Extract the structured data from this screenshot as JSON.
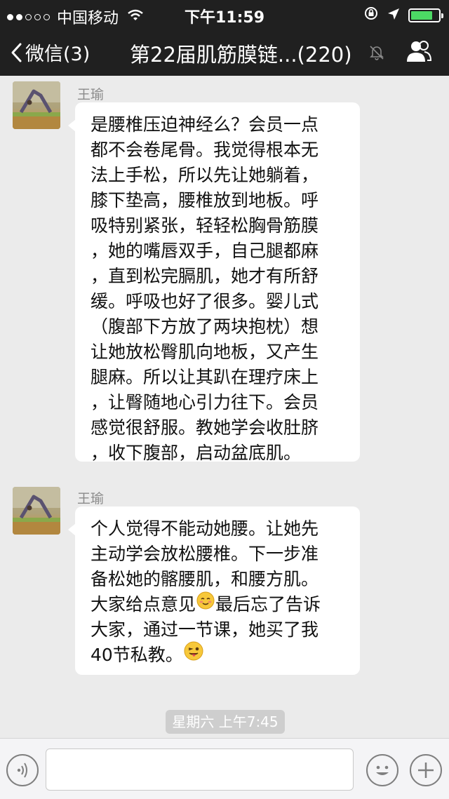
{
  "status_bar": {
    "signal_bars": 5,
    "signal_filled": 2,
    "carrier": "中国移动",
    "time": "下午11:59",
    "battery_color": "#4cd964",
    "battery_level": 0.82
  },
  "nav": {
    "back_label": "微信(3)",
    "title": "第22届肌筋膜链...(220)",
    "icons": [
      "chevron-left-icon",
      "mute-bell-icon",
      "contacts-icon"
    ]
  },
  "messages": [
    {
      "sender": "王瑜",
      "lines": [
        "是腰椎压迫神经么？会员一点",
        "都不会卷尾骨。我觉得根本无",
        "法上手松，所以先让她躺着，",
        "膝下垫高，腰椎放到地板。呼",
        "吸特别紧张，轻轻松胸骨筋膜",
        "，她的嘴唇双手，自己腿都麻",
        "，直到松完膈肌，她才有所舒",
        "缓。呼吸也好了很多。婴儿式",
        "（腹部下方放了两块抱枕）想",
        "让她放松臀肌向地板，又产生",
        "腿麻。所以让其趴在理疗床上",
        "，让臀随地心引力往下。会员",
        "感觉很舒服。教她学会收肚脐",
        "，收下腹部，启动盆底肌。"
      ]
    },
    {
      "sender": "王瑜",
      "lines": [
        "个人觉得不能动她腰。让她先",
        "主动学会放松腰椎。下一步准",
        "备松她的髂腰肌，和腰方肌。",
        "大家给点意见",
        "最后忘了告诉",
        "大家，通过一节课，她买了我",
        "40节私教。"
      ],
      "emojis": [
        "blushing-smile-emoji",
        "winking-tongue-emoji"
      ]
    }
  ],
  "timestamp": "星期六 上午7:45",
  "input_bar": {
    "placeholder": "",
    "icons": [
      "voice-icon",
      "emoji-icon",
      "plus-icon"
    ]
  }
}
